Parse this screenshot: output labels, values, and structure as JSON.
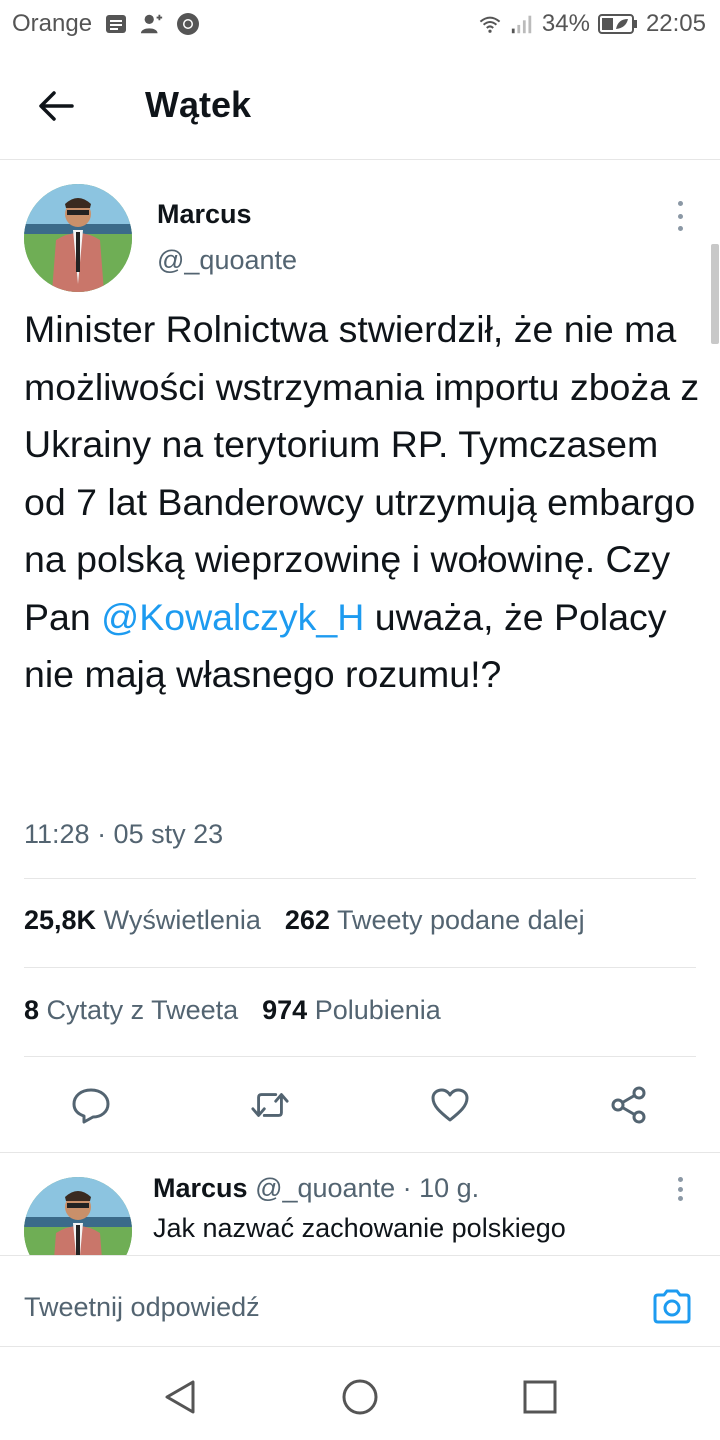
{
  "status_bar": {
    "carrier": "Orange",
    "battery": "34%",
    "time": "22:05"
  },
  "header": {
    "title": "Wątek"
  },
  "tweet": {
    "name": "Marcus",
    "handle": "@_quoante",
    "text_part1": "Minister Rolnictwa stwierdził, że nie ma możliwości wstrzymania importu zboża z Ukrainy na terytorium RP. Tymczasem od 7 lat Banderowcy utrzymują embargo na polską wieprzowinę i wołowinę. Czy Pan ",
    "mention": "@Kowalczyk_H",
    "text_part2": " uważa, że Polacy nie mają własnego rozumu!?",
    "timestamp": "11:28 · 05 sty 23",
    "stats": {
      "views_count": "25,8K",
      "views_label": "Wyświetlenia",
      "retweets_count": "262",
      "retweets_label": "Tweety podane dalej",
      "quotes_count": "8",
      "quotes_label": "Cytaty z Tweeta",
      "likes_count": "974",
      "likes_label": "Polubienia"
    }
  },
  "reply": {
    "name": "Marcus",
    "handle": "@_quoante",
    "time": "· 10 g.",
    "text": "Jak nazwać zachowanie polskiego"
  },
  "composer": {
    "placeholder": "Tweetnij odpowiedź"
  },
  "colors": {
    "accent": "#1d9bf0",
    "text": "#0f1419",
    "muted": "#536471"
  }
}
